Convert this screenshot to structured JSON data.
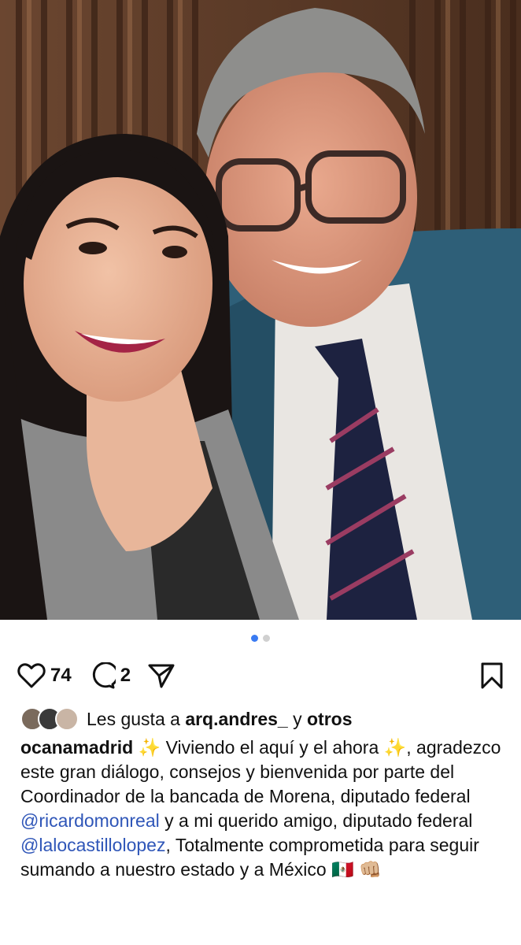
{
  "photo": {
    "description_icon": "photo-of-two-people"
  },
  "carousel": {
    "count": 2,
    "active": 0
  },
  "actions": {
    "like_count": "74",
    "comment_count": "2"
  },
  "likes": {
    "prefix": "Les gusta a",
    "user": "arq.andres_",
    "joiner": "y",
    "others": "otros"
  },
  "caption": {
    "username": "ocanamadrid",
    "sparkle1": "✨",
    "part1": " Viviendo el aquí y el ahora ",
    "sparkle2": "✨",
    "part2": ", agradezco este gran diálogo, consejos  y bienvenida por parte del Coordinador de la bancada de Morena, diputado federal ",
    "mention1": "@ricardomonreal",
    "part3": " y a mi querido amigo, diputado federal ",
    "mention2": "@lalocastillolopez",
    "part4": ", Totalmente comprometida para seguir sumando a nuestro estado y a México ",
    "flag": "🇲🇽",
    "fist": "👊🏼"
  },
  "colors": {
    "mention": "#2f56b8",
    "active_dot": "#3a7bf2"
  }
}
